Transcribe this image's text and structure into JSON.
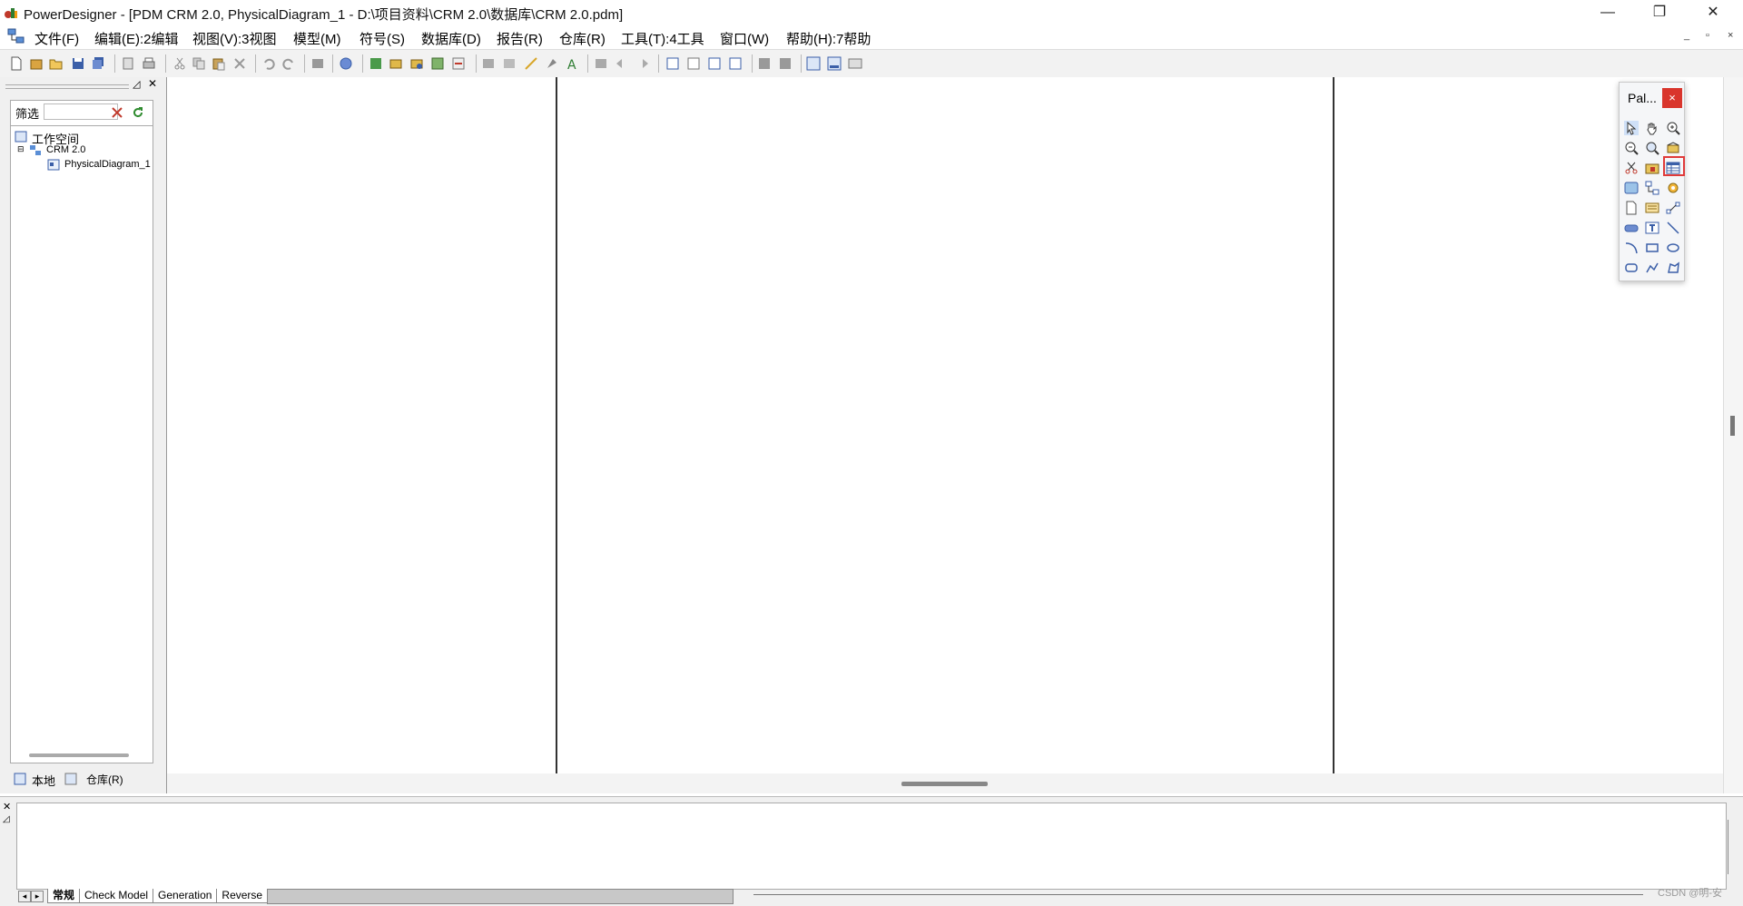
{
  "window": {
    "title": "PowerDesigner - [PDM CRM 2.0, PhysicalDiagram_1 - D:\\项目资料\\CRM 2.0\\数据库\\CRM 2.0.pdm]",
    "min_label": "—",
    "max_label": "❐",
    "close_label": "✕"
  },
  "menu": {
    "items": [
      "文件(F)",
      "编辑(E):2编辑",
      "视图(V):3视图",
      "模型(M)",
      "符号(S)",
      "数据库(D)",
      "报告(R)",
      "仓库(R)",
      "工具(T):4工具",
      "窗口(W)",
      "帮助(H):7帮助"
    ],
    "mdi_min": "_",
    "mdi_restore": "▫",
    "mdi_close": "×"
  },
  "browser": {
    "filter_label": "筛选",
    "filter_value": "",
    "tree": [
      {
        "label": "工作空间"
      },
      {
        "label": "CRM 2.0"
      },
      {
        "label": "PhysicalDiagram_1"
      }
    ],
    "tabs": [
      "本地",
      "仓库(R)"
    ]
  },
  "palette": {
    "title": "Pal...",
    "close": "×",
    "tools": [
      "pointer-icon",
      "grabber-icon",
      "zoom-in-icon",
      "zoom-out-icon",
      "open-package-icon",
      "properties-icon",
      "delete-icon",
      "package-icon",
      "table-icon",
      "view-icon",
      "reference-icon",
      "procedure-icon",
      "file-icon",
      "business-rule-icon",
      "link-icon",
      "text-button-icon",
      "text-icon",
      "line-icon",
      "arc-icon",
      "rectangle-icon",
      "ellipse-icon",
      "rounded-rectangle-icon",
      "polyline-icon",
      "polygon-icon"
    ]
  },
  "output": {
    "tabs": [
      "常规",
      "Check Model",
      "Generation",
      "Reverse"
    ]
  },
  "watermark": "CSDN @明-安",
  "colors": {
    "highlight": "#e03a3a",
    "close_red": "#d9352c"
  }
}
